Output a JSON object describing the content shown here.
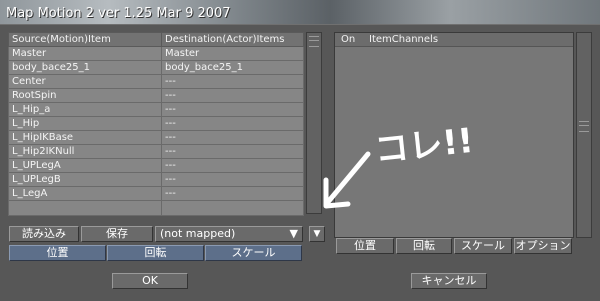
{
  "window": {
    "title": "Map Motion 2 ver 1.25 Mar  9 2007"
  },
  "mapping_table": {
    "col_source": "Source(Motion)Item",
    "col_destination": "Destination(Actor)Items",
    "rows": [
      {
        "source": "Master",
        "destination": "Master"
      },
      {
        "source": "body_bace25_1",
        "destination": "body_bace25_1"
      },
      {
        "source": "Center",
        "destination": "---"
      },
      {
        "source": "RootSpin",
        "destination": "---"
      },
      {
        "source": "L_Hip_a",
        "destination": "---"
      },
      {
        "source": "L_Hip",
        "destination": "---"
      },
      {
        "source": "L_HipIKBase",
        "destination": "---"
      },
      {
        "source": "L_Hip2IKNull",
        "destination": "---"
      },
      {
        "source": "L_UPLegA",
        "destination": "---"
      },
      {
        "source": "L_UPLegB",
        "destination": "---"
      },
      {
        "source": "L_LegA",
        "destination": "---"
      }
    ]
  },
  "left_controls": {
    "load_label": "読み込み",
    "save_label": "保存",
    "mapping_dropdown": "(not mapped)",
    "dropdown_arrow": "▼",
    "position_label": "位置",
    "rotation_label": "回転",
    "scale_label": "スケール"
  },
  "channel_panel": {
    "col_on": "On",
    "col_channels": "ItemChannels"
  },
  "right_controls": {
    "position_label": "位置",
    "rotation_label": "回転",
    "scale_label": "スケール",
    "options_label": "オプション"
  },
  "dialog_buttons": {
    "ok_label": "OK",
    "cancel_label": "キャンセル"
  },
  "annotation": {
    "text": "コレ!!",
    "color": "#ffffff"
  }
}
